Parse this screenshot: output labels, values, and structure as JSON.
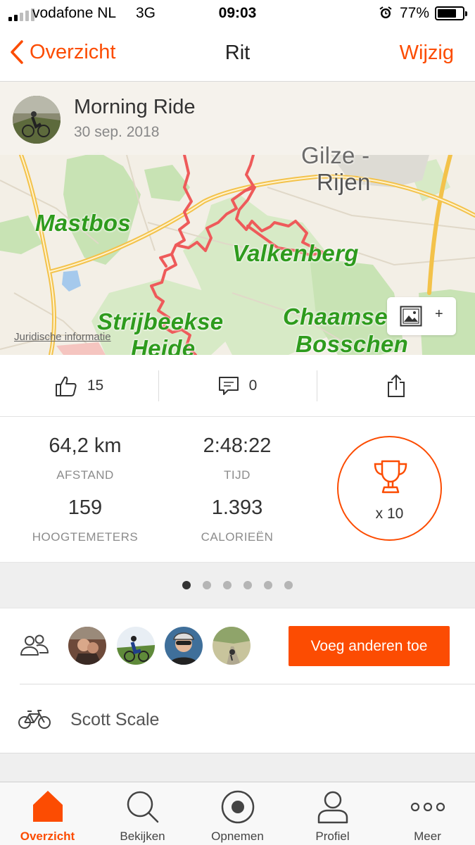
{
  "status_bar": {
    "carrier": "vodafone NL",
    "network": "3G",
    "time": "09:03",
    "battery_percent": "77%",
    "battery_level": 0.77,
    "signal_bars_on": 2,
    "signal_bars_total": 5,
    "icons": [
      "signal-icon",
      "alarm-icon",
      "battery-icon"
    ]
  },
  "nav": {
    "back_label": "Overzicht",
    "title": "Rit",
    "edit_label": "Wijzig"
  },
  "activity": {
    "name": "Morning Ride",
    "date": "30 sep. 2018"
  },
  "map": {
    "labels": {
      "gilze": "Gilze -",
      "rijen": "Rijen",
      "mastbos": "Mastbos",
      "valkenberg": "Valkenberg",
      "strijbeekse": "Strijbeekse",
      "heide": "Heide",
      "chaamse": "Chaamse",
      "bosschen": "Bosschen"
    },
    "legal_link": "Juridische informatie",
    "add_photo_label": "+",
    "route_color": "#ee5a5a",
    "forest_color": "#c8e3b4",
    "road_color": "#f3c24a"
  },
  "social": {
    "kudos_count": "15",
    "comment_count": "0",
    "icons": [
      "thumbs-up-icon",
      "comment-icon",
      "share-icon"
    ]
  },
  "stats": {
    "distance": {
      "value": "64,2 km",
      "label": "AFSTAND"
    },
    "time": {
      "value": "2:48:22",
      "label": "TIJD"
    },
    "elevation": {
      "value": "159",
      "label": "HOOGTEMETERS"
    },
    "calories": {
      "value": "1.393",
      "label": "CALORIEËN"
    },
    "achievements": "x 10"
  },
  "pager": {
    "pages": 6,
    "active_index": 0
  },
  "companions": {
    "count": 4,
    "add_button_label": "Voeg anderen toe"
  },
  "gear": {
    "name": "Scott Scale"
  },
  "tabs": [
    {
      "label": "Overzicht",
      "icon": "home-icon",
      "active": true
    },
    {
      "label": "Bekijken",
      "icon": "search-icon",
      "active": false
    },
    {
      "label": "Opnemen",
      "icon": "record-icon",
      "active": false
    },
    {
      "label": "Profiel",
      "icon": "profile-icon",
      "active": false
    },
    {
      "label": "Meer",
      "icon": "more-icon",
      "active": false
    }
  ],
  "colors": {
    "accent": "#fc4c02",
    "text": "#333333",
    "muted": "#8c8c8c"
  }
}
